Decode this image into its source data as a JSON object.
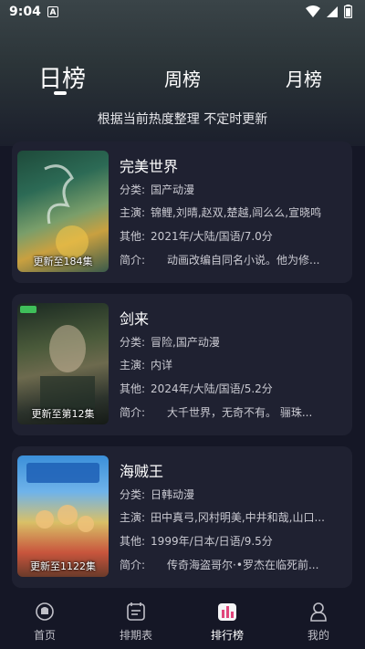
{
  "status": {
    "time": "9:04",
    "notif_icon": "A"
  },
  "tabs": [
    {
      "label": "日榜",
      "active": true
    },
    {
      "label": "周榜",
      "active": false
    },
    {
      "label": "月榜",
      "active": false
    }
  ],
  "subtitle": "根据当前热度整理 不定时更新",
  "cards": [
    {
      "title": "完美世界",
      "episode": "更新至184集",
      "category_label": "分类:",
      "category": "国产动漫",
      "cast_label": "主演:",
      "cast": "锦鲤,刘晴,赵双,楚越,闾么么,宣晓鸣",
      "other_label": "其他:",
      "other": "2021年/大陆/国语/7.0分",
      "intro_label": "简介:",
      "intro": "动画改编自同名小说。他为修..."
    },
    {
      "title": "剑来",
      "episode": "更新至第12集",
      "category_label": "分类:",
      "category": "冒险,国产动漫",
      "cast_label": "主演:",
      "cast": "内详",
      "other_label": "其他:",
      "other": "2024年/大陆/国语/5.2分",
      "intro_label": "简介:",
      "intro": "大千世界，无奇不有。 骊珠..."
    },
    {
      "title": "海贼王",
      "episode": "更新至1122集",
      "category_label": "分类:",
      "category": "日韩动漫",
      "cast_label": "主演:",
      "cast": "田中真弓,冈村明美,中井和哉,山口...",
      "other_label": "其他:",
      "other": "1999年/日本/日语/9.5分",
      "intro_label": "简介:",
      "intro": "传奇海盗哥尔·•罗杰在临死前..."
    }
  ],
  "nav": [
    {
      "label": "首页",
      "icon": "home-icon",
      "active": false
    },
    {
      "label": "排期表",
      "icon": "schedule-icon",
      "active": false
    },
    {
      "label": "排行榜",
      "icon": "ranking-icon",
      "active": true
    },
    {
      "label": "我的",
      "icon": "profile-icon",
      "active": false
    }
  ],
  "colors": {
    "background": "#151726",
    "card": "#1f2131",
    "accent": "#e0457b"
  }
}
